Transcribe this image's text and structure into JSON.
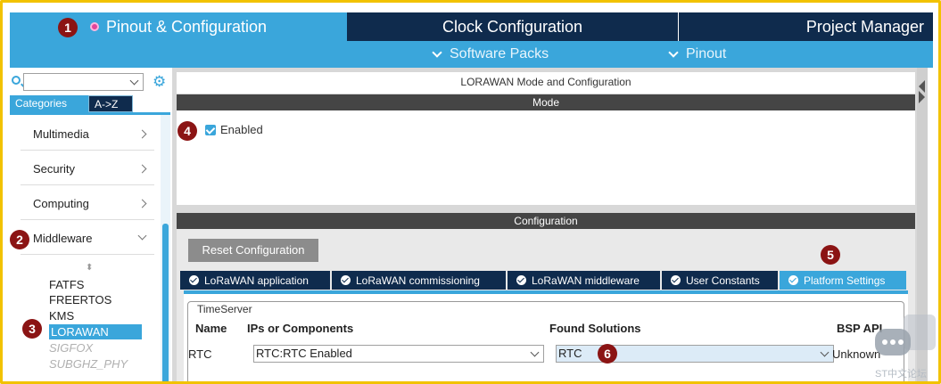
{
  "top_tabs": {
    "pinout": "Pinout & Configuration",
    "clock": "Clock Configuration",
    "project": "Project Manager"
  },
  "sub_menu": {
    "software_packs": "Software Packs",
    "pinout": "Pinout"
  },
  "sidebar": {
    "search": {
      "value": "",
      "placeholder": ""
    },
    "tabs": {
      "categories": "Categories",
      "az": "A->Z"
    },
    "categories": [
      "Multimedia",
      "Security",
      "Computing",
      "Middleware"
    ],
    "middleware_items": [
      {
        "label": "FATFS",
        "state": "normal"
      },
      {
        "label": "FREERTOS",
        "state": "normal"
      },
      {
        "label": "KMS",
        "state": "normal"
      },
      {
        "label": "LORAWAN",
        "state": "selected"
      },
      {
        "label": "SIGFOX",
        "state": "disabled"
      },
      {
        "label": "SUBGHZ_PHY",
        "state": "disabled"
      }
    ]
  },
  "main": {
    "title": "LORAWAN Mode and Configuration",
    "mode_header": "Mode",
    "enabled_label": "Enabled",
    "enabled_checked": true,
    "config_header": "Configuration",
    "reset_button": "Reset Configuration",
    "param_tabs": [
      "LoRaWAN application",
      "LoRaWAN commissioning",
      "LoRaWAN middleware",
      "User Constants",
      "Platform Settings"
    ],
    "active_param_tab": "Platform Settings",
    "timeserver": {
      "legend": "TimeServer",
      "headers": {
        "name": "Name",
        "ips": "IPs or Components",
        "found": "Found Solutions",
        "bsp": "BSP API"
      },
      "row": {
        "name": "RTC",
        "ips": "RTC:RTC Enabled",
        "found": "RTC",
        "bsp": "Unknown"
      }
    }
  },
  "callouts": [
    "1",
    "2",
    "3",
    "4",
    "5",
    "6"
  ],
  "watermark": "ST中文论坛",
  "colors": {
    "accent": "#3aa6db",
    "dark_navy": "#0f2b4d",
    "frame": "#f2c200",
    "callout": "#8b1414",
    "header_bar": "#454545"
  }
}
